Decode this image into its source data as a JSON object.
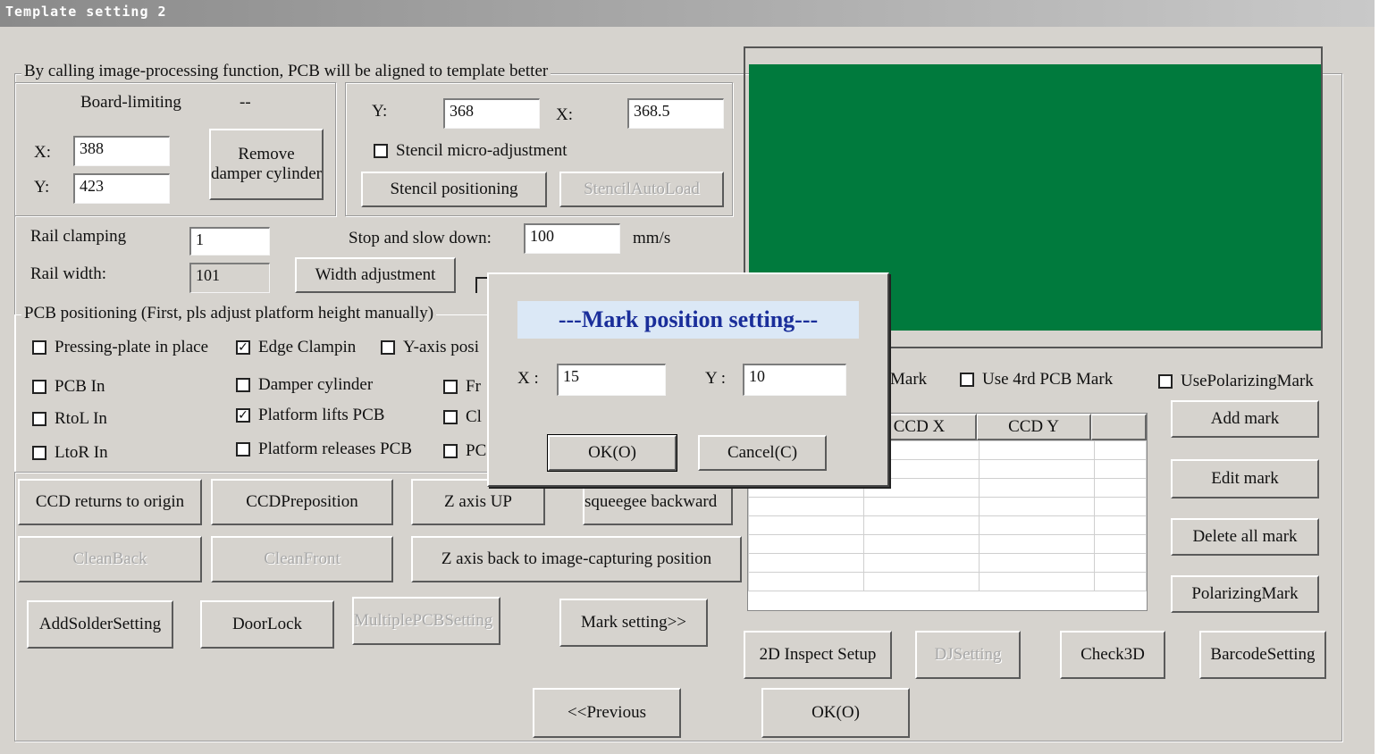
{
  "window": {
    "title": "Template setting 2"
  },
  "align_group": {
    "legend": "By calling image-processing function, PCB will be aligned to template better",
    "board_limiting_label": "Board-limiting",
    "board_limiting_value": "--",
    "x_label": "X:",
    "x_value": "388",
    "y_label": "Y:",
    "y_value": "423",
    "remove_damper_button": "Remove damper cylinder",
    "stencil_y_label": "Y:",
    "stencil_y_value": "368",
    "stencil_x_label": "X:",
    "stencil_x_value": "368.5",
    "stencil_micro_label": "Stencil micro-adjustment",
    "stencil_positioning_button": "Stencil positioning",
    "stencil_autoload_button": "StencilAutoLoad"
  },
  "rail": {
    "clamping_label": "Rail clamping",
    "clamping_value": "1",
    "stop_label": "Stop and slow down:",
    "stop_value": "100",
    "stop_unit": "mm/s",
    "width_label": "Rail width:",
    "width_value": "101",
    "width_adjust_button": "Width adjustment"
  },
  "pcb_group": {
    "legend": "PCB positioning (First, pls adjust platform height manually)",
    "checks": {
      "pressing_plate": {
        "label": "Pressing-plate in place",
        "checked": false
      },
      "edge_clamping": {
        "label": "Edge Clampin",
        "checked": true
      },
      "y_axis": {
        "label": "Y-axis posi",
        "checked": false
      },
      "pcb_in": {
        "label": "PCB In",
        "checked": false
      },
      "damper": {
        "label": "Damper cylinder",
        "checked": false
      },
      "fr": {
        "label": "Fr",
        "checked": false
      },
      "rtol": {
        "label": "RtoL In",
        "checked": false
      },
      "lifts": {
        "label": "Platform lifts PCB",
        "checked": true
      },
      "cl": {
        "label": "Cl",
        "checked": false
      },
      "ltor": {
        "label": "LtoR In",
        "checked": false
      },
      "releases": {
        "label": "Platform releases PCB",
        "checked": false
      },
      "pc": {
        "label": "PC",
        "checked": false
      }
    }
  },
  "buttons": {
    "ccd_origin": "CCD returns to origin",
    "ccd_preposition": "CCDPreposition",
    "z_up": "Z axis UP",
    "squeegee_backward": "squeegee backward",
    "clean_back": "CleanBack",
    "clean_front": "CleanFront",
    "z_back": "Z axis back to image-capturing position",
    "add_solder": "AddSolderSetting",
    "door_lock": "DoorLock",
    "multiple_pcb": "MultiplePCBSetting",
    "mark_setting": "Mark setting>>",
    "previous": "<<Previous",
    "ok": "OK(O)"
  },
  "mark_panel": {
    "mark_partial": "Mark",
    "use_4rd_label": "Use 4rd PCB  Mark",
    "use_polarizing_label": "UsePolarizingMark",
    "col_ccd_x": "CCD X",
    "col_ccd_y": "CCD Y",
    "add_mark": "Add mark",
    "edit_mark": "Edit mark",
    "delete_all_mark": "Delete all mark",
    "polarizing_mark": "PolarizingMark",
    "inspect_2d": "2D  Inspect Setup",
    "dj_setting": "DJSetting",
    "check_3d": "Check3D",
    "barcode_setting": "BarcodeSetting"
  },
  "dialog": {
    "title": "---Mark position setting---",
    "x_label": "X :",
    "x_value": "15",
    "y_label": "Y :",
    "y_value": "10",
    "ok": "OK(O)",
    "cancel": "Cancel(C)"
  },
  "colors": {
    "preview": "#007a3d",
    "dialog_title": "#1a2e9a",
    "dialog_title_bg": "#dbe8f6",
    "window_bg": "#d6d3ce"
  }
}
